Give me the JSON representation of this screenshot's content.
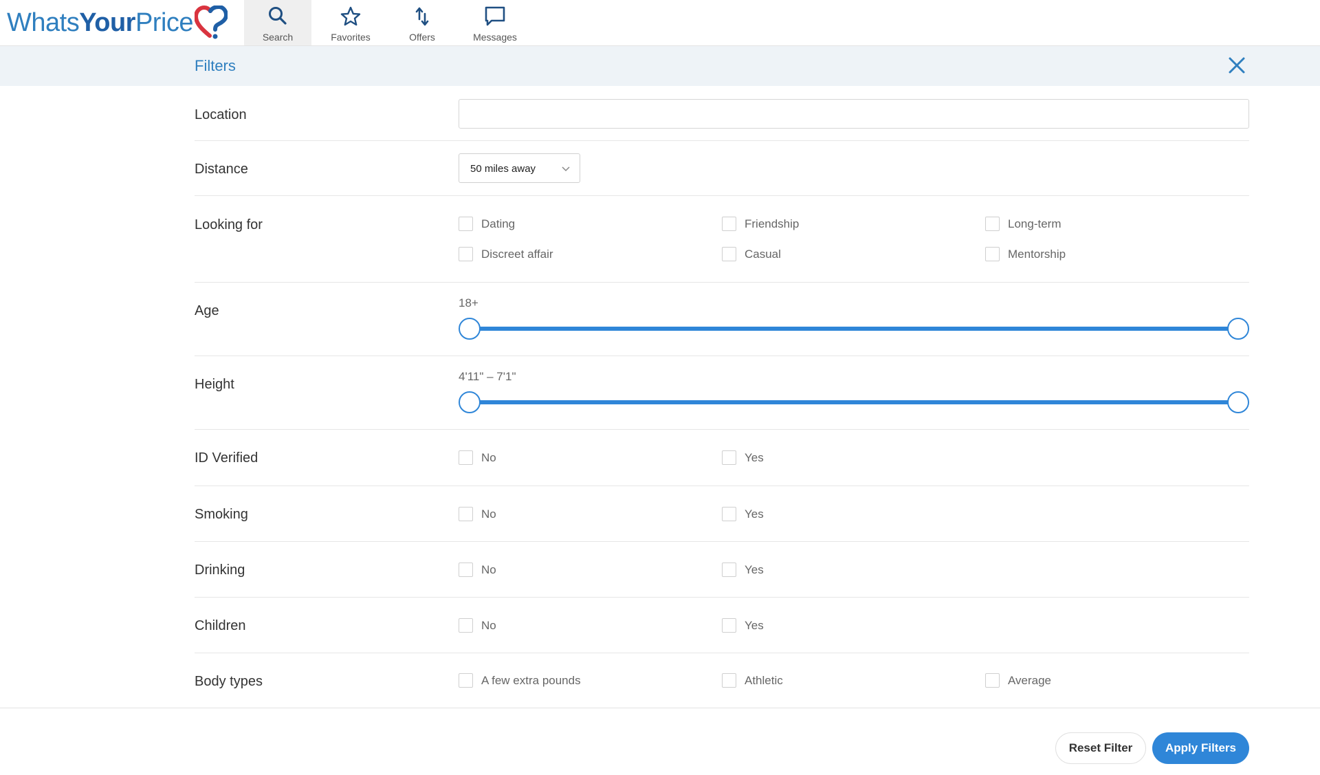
{
  "brand": {
    "part1": "Whats",
    "part2": "Your",
    "part3": "Price"
  },
  "nav": {
    "search": "Search",
    "favorites": "Favorites",
    "offers": "Offers",
    "messages": "Messages"
  },
  "filters": {
    "title": "Filters",
    "location": {
      "label": "Location",
      "value": "",
      "placeholder": ""
    },
    "distance": {
      "label": "Distance",
      "selected": "50 miles away"
    },
    "looking_for": {
      "label": "Looking for",
      "options": [
        "Dating",
        "Friendship",
        "Long-term",
        "Discreet affair",
        "Casual",
        "Mentorship"
      ]
    },
    "age": {
      "label": "Age",
      "display": "18+",
      "min": 0.0,
      "max": 1.0
    },
    "height": {
      "label": "Height",
      "display": "4'11\" – 7'1\"",
      "min": 0.0,
      "max": 1.0
    },
    "id_verified": {
      "label": "ID Verified",
      "options": [
        "No",
        "Yes"
      ]
    },
    "smoking": {
      "label": "Smoking",
      "options": [
        "No",
        "Yes"
      ]
    },
    "drinking": {
      "label": "Drinking",
      "options": [
        "No",
        "Yes"
      ]
    },
    "children": {
      "label": "Children",
      "options": [
        "No",
        "Yes"
      ]
    },
    "body_types": {
      "label": "Body types",
      "options": [
        "A few extra pounds",
        "Athletic",
        "Average"
      ]
    }
  },
  "footer": {
    "reset": "Reset Filter",
    "apply": "Apply Filters"
  },
  "colors": {
    "accent": "#2f86d8",
    "brand_blue": "#2f7fbf",
    "brand_dark": "#1f5fa6",
    "heart_red": "#d9343f",
    "bar_bg": "#eef3f7"
  }
}
